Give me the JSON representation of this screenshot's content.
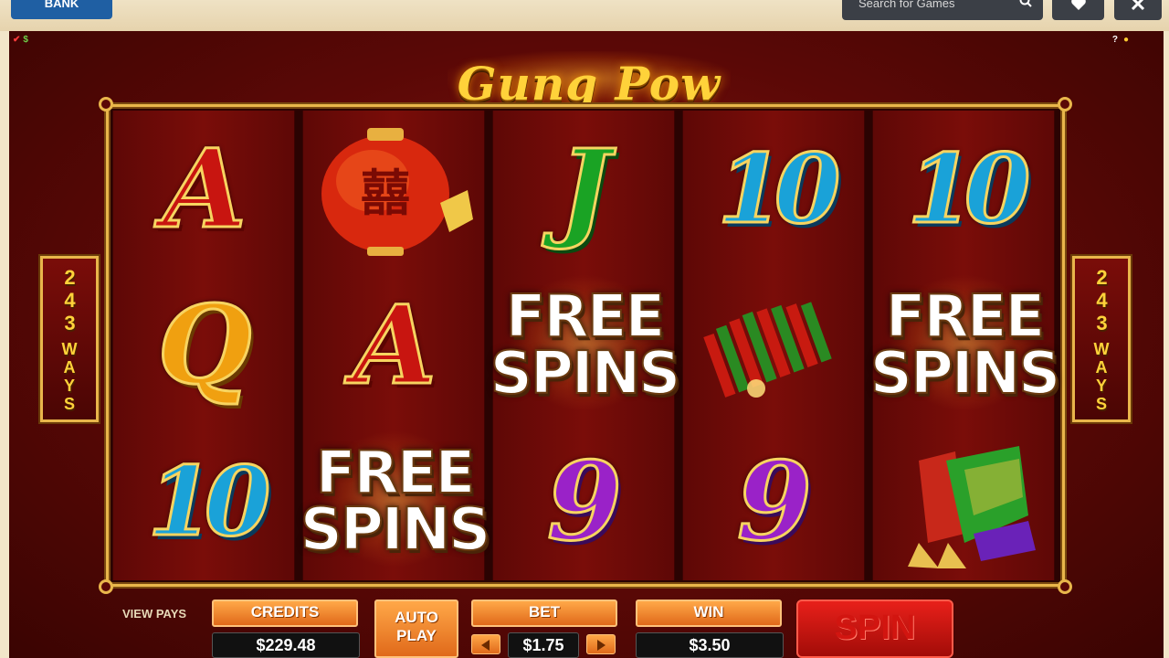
{
  "topbar": {
    "bank_label": "BANK",
    "search_placeholder": "Search for Games"
  },
  "game": {
    "title": "Gung Pow",
    "ways_number": "243",
    "ways_word": "WAYS",
    "reels": [
      [
        "A",
        "Q",
        "10"
      ],
      [
        "lantern",
        "A",
        "FREE SPINS"
      ],
      [
        "J",
        "FREE SPINS",
        "9"
      ],
      [
        "10",
        "firecrackers",
        "9"
      ],
      [
        "10",
        "FREE SPINS",
        "rockets"
      ]
    ],
    "free_spins_line1": "FREE",
    "free_spins_line2": "SPINS"
  },
  "controls": {
    "view_pays": "VIEW PAYS",
    "credits_label": "CREDITS",
    "credits_value": "$229.48",
    "autoplay_line1": "AUTO",
    "autoplay_line2": "PLAY",
    "bet_label": "BET",
    "bet_value": "$1.75",
    "win_label": "WIN",
    "win_value": "$3.50",
    "spin_label": "SPIN"
  },
  "colors": {
    "bank_blue": "#1f5fa3",
    "frame_gold": "#e9b64b",
    "button_orange": "#e0691a",
    "spin_red": "#d21510"
  }
}
